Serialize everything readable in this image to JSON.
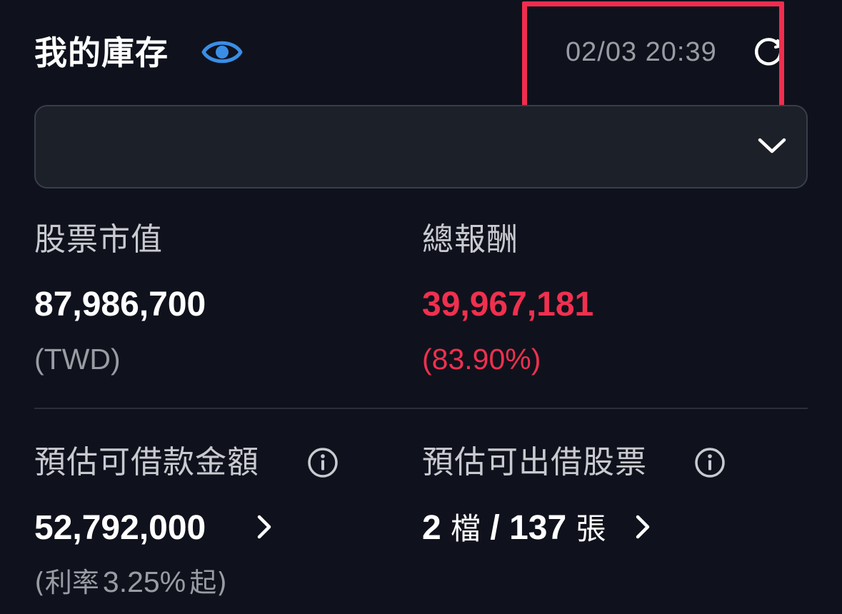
{
  "header": {
    "title": "我的庫存",
    "timestamp": "02/03 20:39"
  },
  "stock_value": {
    "label": "股票市值",
    "value": "87,986,700",
    "currency": "(TWD)"
  },
  "total_return": {
    "label": "總報酬",
    "value": "39,967,181",
    "percent": "(83.90%)",
    "color": "#f0304f"
  },
  "loan_amount": {
    "label": "預估可借款金額",
    "value": "52,792,000",
    "rate_prefix": "(利率",
    "rate_value": "3.25%",
    "rate_suffix": "起)"
  },
  "lendable_stocks": {
    "label": "預估可出借股票",
    "count": "2",
    "count_unit": "檔",
    "separator": "/",
    "shares": "137",
    "shares_unit": "張"
  },
  "icons": {
    "visibility": "eye-icon",
    "refresh": "refresh-icon",
    "dropdown": "chevron-down-icon",
    "info": "info-icon",
    "navigate": "chevron-right-icon"
  },
  "colors": {
    "background": "#0f121c",
    "accent": "#3a8ee6",
    "negative_or_gain": "#f0304f",
    "highlight": "#f02d4f"
  }
}
